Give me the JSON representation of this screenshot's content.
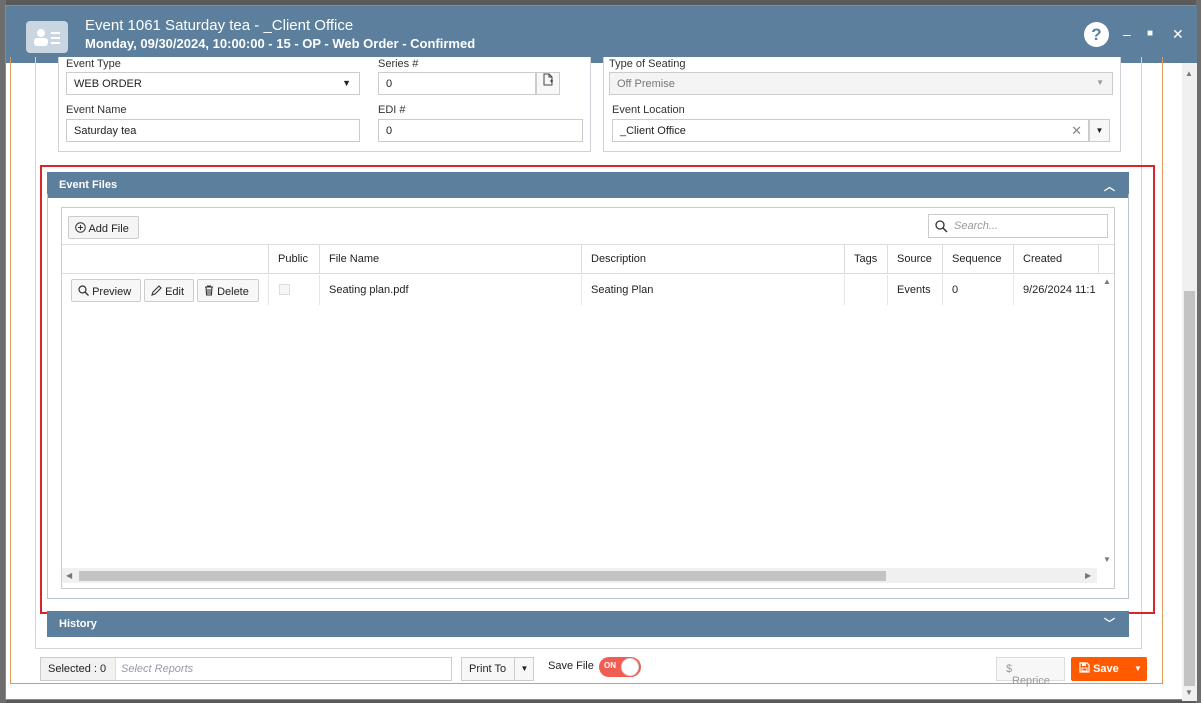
{
  "window": {
    "title": "Event 1061 Saturday tea - _Client Office",
    "subtitle": "Monday, 09/30/2024, 10:00:00 - 15 - OP - Web Order - Confirmed",
    "help": "?",
    "minimize": "–",
    "maximize": "■",
    "close": "✕"
  },
  "form": {
    "event_type_label": "Event Type",
    "event_type_value": "WEB ORDER",
    "series_label": "Series #",
    "series_value": "0",
    "type_of_seating_label": "Type of Seating",
    "type_of_seating_value": "Off Premise",
    "event_name_label": "Event Name",
    "event_name_value": "Saturday tea",
    "edi_label": "EDI #",
    "edi_value": "0",
    "event_location_label": "Event Location",
    "event_location_value": "_Client Office"
  },
  "event_files": {
    "header": "Event Files",
    "add_file": "Add File",
    "search_placeholder": "Search...",
    "columns": [
      "Public",
      "File Name",
      "Description",
      "Tags",
      "Source",
      "Sequence",
      "Created"
    ],
    "row_actions": {
      "preview": "Preview",
      "edit": "Edit",
      "delete": "Delete"
    },
    "rows": [
      {
        "public": false,
        "file_name": "Seating plan.pdf",
        "description": "Seating Plan",
        "tags": "",
        "source": "Events",
        "sequence": "0",
        "created": "9/26/2024 11:1"
      }
    ]
  },
  "history": {
    "header": "History"
  },
  "footer": {
    "selected_label": "Selected : 0",
    "select_reports_placeholder": "Select Reports",
    "print_to": "Print To",
    "save_file_label": "Save File",
    "save_file_toggle": "ON",
    "reprice": "Reprice",
    "save": "Save"
  },
  "colors": {
    "titlebar": "#5b7f9c",
    "panel_header": "#5b7f9c",
    "highlight": "#d9262a",
    "save_button": "#ff5a00",
    "toggle_on": "#f05d52"
  }
}
